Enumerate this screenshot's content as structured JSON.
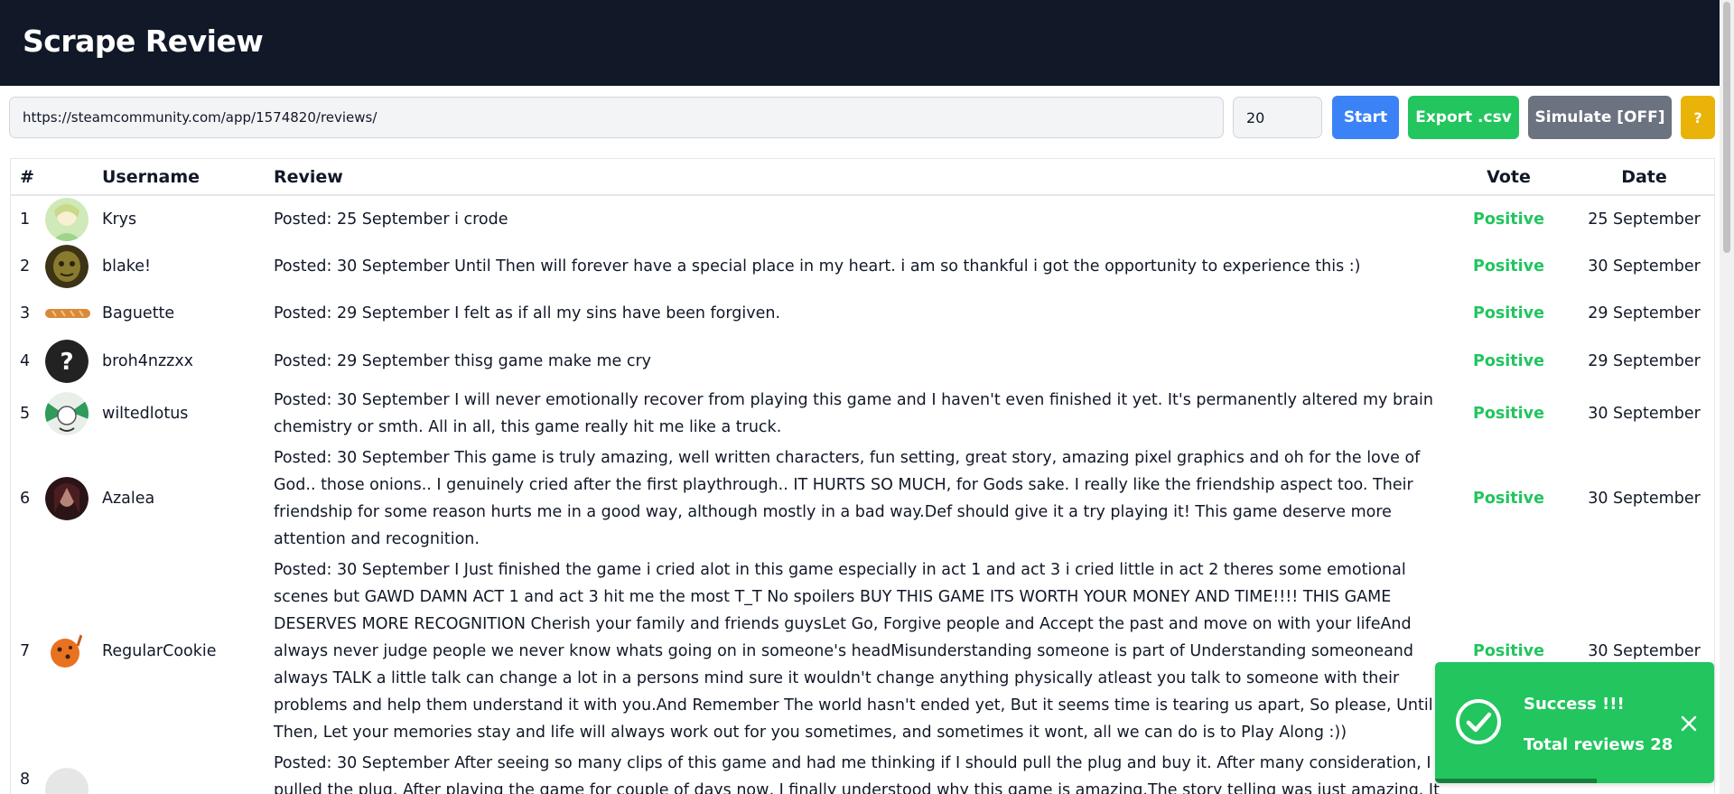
{
  "app": {
    "title": "Scrape Review"
  },
  "toolbar": {
    "url_value": "https://steamcommunity.com/app/1574820/reviews/",
    "count_value": "20",
    "start_label": "Start",
    "export_label": "Export .csv",
    "simulate_label": "Simulate [OFF]",
    "help_label": "?"
  },
  "table": {
    "headers": {
      "num": "#",
      "username": "Username",
      "review": "Review",
      "vote": "Vote",
      "date": "Date"
    },
    "rows": [
      {
        "num": "1",
        "username": "Krys",
        "review": "Posted: 25 September i crode",
        "vote": "Positive",
        "date": "25 September",
        "avatar": "green-anime-avatar"
      },
      {
        "num": "2",
        "username": "blake!",
        "review": "Posted: 30 September Until Then will forever have a special place in my heart. i am so thankful i got the opportunity to experience this :)",
        "vote": "Positive",
        "date": "30 September",
        "avatar": "dark-mask-avatar"
      },
      {
        "num": "3",
        "username": "Baguette",
        "review": "Posted: 29 September I felt as if all my sins have been forgiven.",
        "vote": "Positive",
        "date": "29 September",
        "avatar": "baguette-avatar"
      },
      {
        "num": "4",
        "username": "broh4nzzxx",
        "review": "Posted: 29 September thisg game make me cry",
        "vote": "Positive",
        "date": "29 September",
        "avatar": "question-mark-avatar"
      },
      {
        "num": "5",
        "username": "wiltedlotus",
        "review": "Posted: 30 September I will never emotionally recover from playing this game and I haven't even finished it yet. It's permanently altered my brain chemistry or smth. All in all, this game really hit me like a truck.",
        "vote": "Positive",
        "date": "30 September",
        "avatar": "green-white-avatar"
      },
      {
        "num": "6",
        "username": "Azalea",
        "review": "Posted: 30 September This game is truly amazing, well written characters, fun setting, great story, amazing pixel graphics and oh for the love of God.. those onions.. I genuinely cried after the first playthrough.. IT HURTS SO MUCH, for Gods sake. I really like the friendship aspect too. Their friendship for some reason hurts me in a good way, although mostly in a bad way.Def should give it a try playing it! This game deserve more attention and recognition.",
        "vote": "Positive",
        "date": "30 September",
        "avatar": "dark-portrait-avatar"
      },
      {
        "num": "7",
        "username": "RegularCookie",
        "review": "Posted: 30 September I Just finished the game i cried alot in this game especially in act 1 and act 3 i cried little in act 2 theres some emotional scenes but GAWD DAMN ACT 1 and act 3 hit me the most T_T No spoilers BUY THIS GAME ITS WORTH YOUR MONEY AND TIME!!!! THIS GAME DESERVES MORE RECOGNITION Cherish your family and friends guysLet Go, Forgive people and Accept the past and move on with your lifeAnd always never judge people we never know whats going on in someone's headMisunderstanding someone is part of Understanding someoneand always TALK a little talk can change a lot in a persons mind sure it wouldn't change anything physically atleast you talk to someone with their problems and help them understand it with you.And Remember The world hasn't ended yet, But it seems time is tearing us apart, So please, Until Then, Let your memories stay and life will always work out for you sometimes, and sometimes it wont, all we can do is to Play Along :))",
        "vote": "Positive",
        "date": "30 September",
        "avatar": "cookie-avatar"
      },
      {
        "num": "8",
        "username": "",
        "review": "Posted: 30 September After seeing so many clips of this game and had me thinking if I should pull the plug and buy it. After many consideration, I pulled the plug. After playing the game for couple of days now, I finally understood why this game is amazing.The story telling was just amazing. It",
        "vote": "",
        "date": "",
        "avatar": "light-avatar"
      }
    ]
  },
  "toast": {
    "title": "Success !!!",
    "message": "Total reviews 28",
    "progress": 0.58,
    "icon": "check-circle-icon",
    "color": "#22c55e"
  },
  "colors": {
    "header_bg": "#111827",
    "start": "#3b82f6",
    "export": "#22c55e",
    "simulate": "#6b7280",
    "help": "#eab308",
    "positive": "#22c55e"
  }
}
